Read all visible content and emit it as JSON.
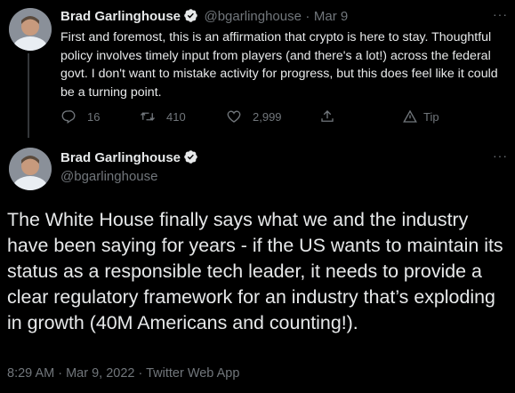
{
  "tweet1": {
    "author_name": "Brad Garlinghouse",
    "handle": "@bgarlinghouse",
    "separator": "·",
    "date": "Mar 9",
    "text": "First and foremost, this is an affirmation that crypto is here to stay. Thoughtful policy involves timely input from players (and there's a lot!) across the federal govt. I don't want to mistake activity for progress, but this does feel like it could be a turning point.",
    "replies": "16",
    "retweets": "410",
    "likes": "2,999",
    "tip_label": "Tip",
    "more_label": "···"
  },
  "tweet2": {
    "author_name": "Brad Garlinghouse",
    "handle": "@bgarlinghouse",
    "text": "The White House finally says what we and the industry have been saying for years - if the US wants to maintain its status as a responsible tech leader, it needs to provide a clear regulatory framework for an industry that’s exploding in growth (40M Americans and counting!).",
    "meta": "8:29 AM · Mar 9, 2022 · Twitter Web App",
    "more_label": "···"
  },
  "colors": {
    "background": "#000000",
    "text_primary": "#e7e9ea",
    "text_secondary": "#71767b",
    "verified_badge": "#e7e9ea"
  }
}
